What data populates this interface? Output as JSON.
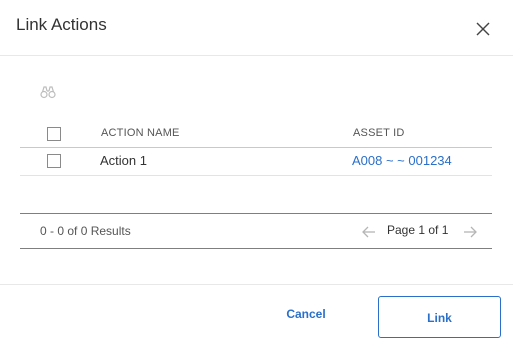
{
  "dialog": {
    "title": "Link Actions"
  },
  "icons": {
    "close": "close-icon",
    "search": "binoculars-icon",
    "prev": "arrow-left-icon",
    "next": "arrow-right-icon"
  },
  "grid": {
    "columns": [
      "ACTION NAME",
      "ASSET ID"
    ],
    "rows": [
      {
        "action_name": "Action 1",
        "asset_id": "A008 ~ ~ 001234",
        "selected": false
      }
    ],
    "select_all": false
  },
  "pager": {
    "results": "0 - 0 of 0 Results",
    "page_label": "Page 1 of 1"
  },
  "footer": {
    "cancel_label": "Cancel",
    "link_label": "Link"
  },
  "colors": {
    "accent": "#2a6fca",
    "text": "#333333",
    "muted": "#555555"
  }
}
